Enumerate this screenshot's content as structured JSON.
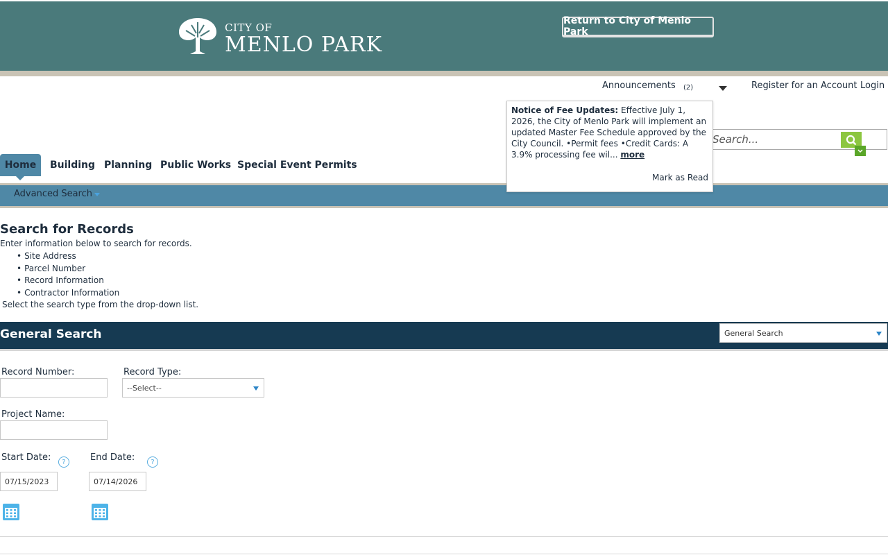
{
  "header": {
    "logo_small": "CITY OF",
    "logo_big": "MENLO PARK",
    "return_button": "Return to City of Menlo Park"
  },
  "toplinks": {
    "announcements": "Announcements",
    "announcements_count": "(2)",
    "register": "Register for an Account",
    "login": "Login"
  },
  "announcement": {
    "title": "Notice of Fee Updates:",
    "body": " Effective July 1, 2026, the City of Menlo Park will implement an updated Master Fee Schedule approved by the City Council. •Permit fees •Credit Cards: A 3.9% processing fee wil... ",
    "more": "more",
    "mark_read": "Mark as Read"
  },
  "global_search": {
    "placeholder": "Search..."
  },
  "nav": {
    "tabs": [
      {
        "label": "Home",
        "active": true
      },
      {
        "label": "Building"
      },
      {
        "label": "Planning"
      },
      {
        "label": "Public Works"
      },
      {
        "label": "Special Event Permits"
      }
    ],
    "subnav": {
      "advanced_search": "Advanced Search"
    }
  },
  "intro": {
    "title": "Search for Records",
    "text": "Enter information below to search for records.",
    "items": [
      "Site Address",
      "Parcel Number",
      "Record Information",
      "Contractor Information"
    ],
    "select_hint": "Select the search type from the drop-down list."
  },
  "section": {
    "title": "General Search",
    "search_type_selected": "General Search"
  },
  "form": {
    "record_number_label": "Record Number:",
    "record_number_value": "",
    "record_type_label": "Record Type:",
    "record_type_selected": "--Select--",
    "project_name_label": "Project Name:",
    "project_name_value": "",
    "start_date_label": "Start Date:",
    "start_date_value": "07/15/2023",
    "end_date_label": "End Date:",
    "end_date_value": "07/14/2026",
    "help_glyph": "?"
  },
  "colors": {
    "header_bg": "#4a7a7b",
    "nav_blue": "#4f88a6",
    "section_navy": "#163a52",
    "search_green": "#8cc63f"
  }
}
